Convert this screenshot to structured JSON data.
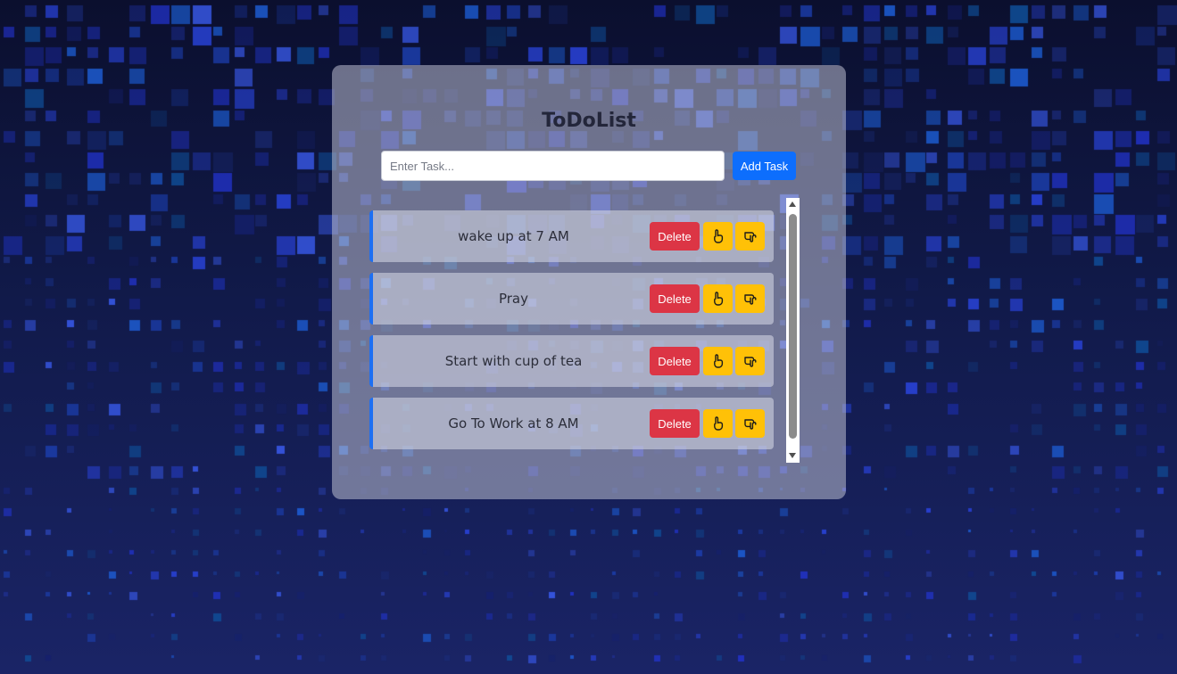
{
  "app": {
    "title": "ToDoList"
  },
  "input": {
    "value": "",
    "placeholder": "Enter Task..."
  },
  "buttons": {
    "add_label": "Add Task"
  },
  "tasks": [
    {
      "text": "wake up at 7 AM",
      "delete_label": "Delete",
      "up_icon": "hand-point-up-icon",
      "down_icon": "hand-point-down-icon"
    },
    {
      "text": "Pray",
      "delete_label": "Delete",
      "up_icon": "hand-point-up-icon",
      "down_icon": "hand-point-down-icon"
    },
    {
      "text": "Start with cup of tea",
      "delete_label": "Delete",
      "up_icon": "hand-point-up-icon",
      "down_icon": "hand-point-down-icon"
    },
    {
      "text": "Go To Work at 8 AM",
      "delete_label": "Delete",
      "up_icon": "hand-point-up-icon",
      "down_icon": "hand-point-down-icon"
    }
  ],
  "colors": {
    "primary": "#0d6efd",
    "danger": "#dc3545",
    "warning": "#ffc107",
    "task_accent": "#1d6ff2",
    "background_dark": "#0b0f2e",
    "background_light": "#1a2466"
  }
}
